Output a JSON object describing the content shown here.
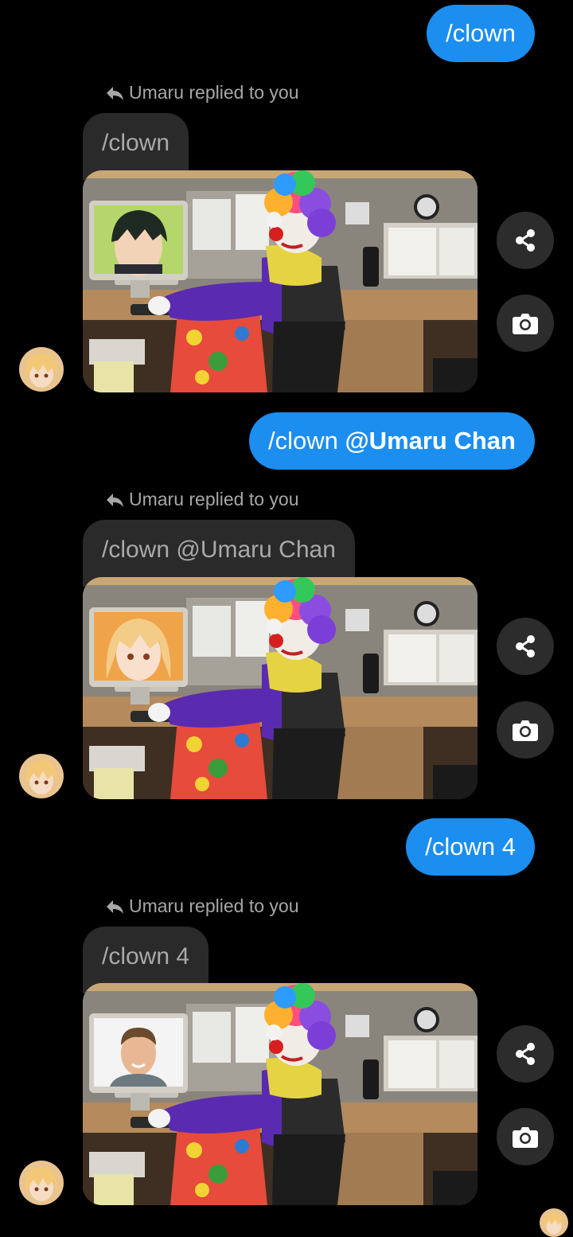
{
  "messages": [
    {
      "sent_text": "/clown",
      "sent_mention": "",
      "reply_label": "Umaru replied to you",
      "quoted_text": "/clown",
      "monitor": "anime-boy"
    },
    {
      "sent_text": "/clown ",
      "sent_mention": "@Umaru Chan",
      "reply_label": "Umaru replied to you",
      "quoted_text": "/clown @Umaru Chan",
      "monitor": "anime-girl"
    },
    {
      "sent_text": "/clown 4",
      "sent_mention": "",
      "reply_label": "Umaru replied to you",
      "quoted_text": "/clown 4",
      "monitor": "man-photo"
    }
  ],
  "icons": {
    "share": "share-icon",
    "camera": "camera-icon",
    "reply": "reply-arrow-icon"
  },
  "colors": {
    "sent_bubble": "#1b8ef0",
    "received_bubble": "#2a2a2a",
    "background": "#000000"
  }
}
